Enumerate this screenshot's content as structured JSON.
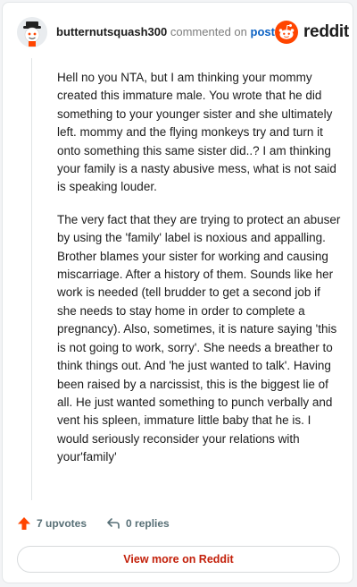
{
  "header": {
    "author": "butternutsquash300",
    "verb": "commented on",
    "post_link": "post",
    "brand": "reddit"
  },
  "comment": {
    "paragraphs": [
      "Hell no you NTA, but I am thinking your mommy created this immature male. You wrote that he did something to your younger sister and she ultimately left. mommy and the flying monkeys try and turn it onto something this same sister did..? I am thinking your family is a nasty abusive mess, what is not said is speaking louder.",
      "The very fact that they are trying to protect an abuser by using the 'family' label is noxious and appalling. Brother blames your sister for working and causing miscarriage. After a history of them. Sounds like her work is needed (tell brudder to get a second job if she needs to stay home in order to complete a pregnancy). Also, sometimes, it is nature saying 'this is not going to work, sorry'. She needs a breather to think things out. And 'he just wanted to talk'. Having been raised by a narcissist, this is the biggest lie of all. He just wanted something to punch verbally and vent his spleen, immature little baby that he is. I would seriously reconsider your relations with your'family'"
    ]
  },
  "actions": {
    "upvotes": "7 upvotes",
    "replies": "0 replies"
  },
  "cta": {
    "label": "View more on Reddit"
  },
  "colors": {
    "reddit_orange": "#ff4500",
    "link_blue": "#0b61c3",
    "cta_red": "#c3200a"
  }
}
